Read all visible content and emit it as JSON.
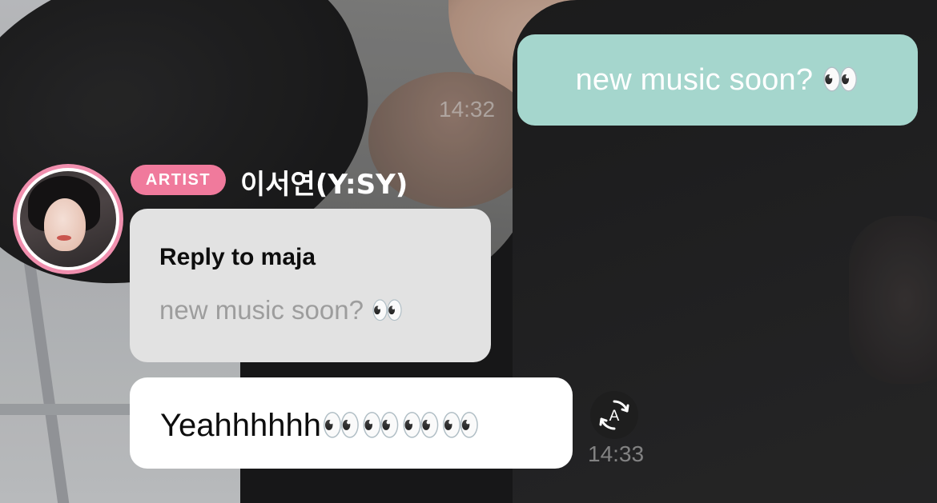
{
  "chat": {
    "outgoing_message": {
      "text": "new music soon? 👀",
      "time": "14:32"
    },
    "incoming": {
      "badge": "ARTIST",
      "sender": "이서연(Y:SY)",
      "reply": {
        "label": "Reply to maja",
        "quoted_text": "new music soon? 👀"
      },
      "message_text": "Yeahhhhhh👀👀👀👀",
      "time": "14:33",
      "translate_icon": "auto-translate-icon"
    }
  },
  "colors": {
    "outgoing_bubble": "#a5d6cd",
    "artist_badge": "#f07a9c",
    "avatar_ring": "#f08fae",
    "reply_bubble": "#e2e2e2",
    "incoming_bubble": "#ffffff"
  }
}
